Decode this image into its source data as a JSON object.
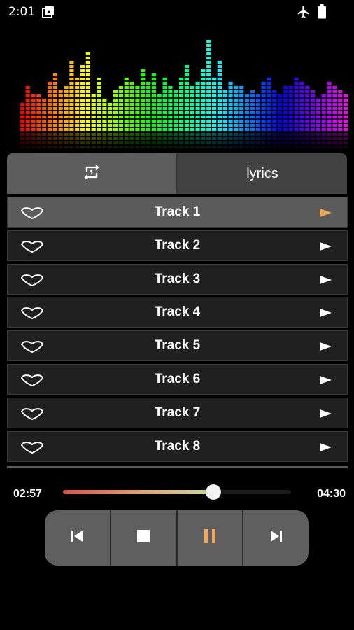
{
  "status_bar": {
    "time": "2:01",
    "left_icon": "notification-gallery-icon",
    "right_icons": [
      "airplane-mode-icon",
      "battery-icon"
    ]
  },
  "visualizer": {
    "levels": [
      0.32,
      0.45,
      0.38,
      0.4,
      0.35,
      0.5,
      0.6,
      0.42,
      0.48,
      0.72,
      0.55,
      0.65,
      0.78,
      0.4,
      0.55,
      0.35,
      0.3,
      0.42,
      0.45,
      0.55,
      0.5,
      0.45,
      0.62,
      0.52,
      0.6,
      0.4,
      0.55,
      0.48,
      0.42,
      0.55,
      0.65,
      0.45,
      0.5,
      0.62,
      0.92,
      0.55,
      0.7,
      0.42,
      0.5,
      0.48,
      0.45,
      0.38,
      0.42,
      0.4,
      0.5,
      0.55,
      0.42,
      0.38,
      0.45,
      0.48,
      0.55,
      0.5,
      0.45,
      0.42,
      0.35,
      0.4,
      0.5,
      0.45,
      0.42,
      0.4
    ]
  },
  "tabs": {
    "repeat_icon": "repeat-one-icon",
    "lyrics_label": "lyrics"
  },
  "tracks": [
    {
      "title": "Track 1",
      "active": true
    },
    {
      "title": "Track 2",
      "active": false
    },
    {
      "title": "Track 3",
      "active": false
    },
    {
      "title": "Track 4",
      "active": false
    },
    {
      "title": "Track 5",
      "active": false
    },
    {
      "title": "Track 6",
      "active": false
    },
    {
      "title": "Track 7",
      "active": false
    },
    {
      "title": "Track 8",
      "active": false
    }
  ],
  "player": {
    "current_time": "02:57",
    "total_time": "04:30",
    "progress": 0.66
  },
  "controls": {
    "previous_icon": "skip-previous-icon",
    "stop_icon": "stop-icon",
    "pause_icon": "pause-icon",
    "next_icon": "skip-next-icon"
  },
  "colors": {
    "accent": "#f2a65a",
    "active_row": "#5b5b5b",
    "row": "#202020"
  }
}
